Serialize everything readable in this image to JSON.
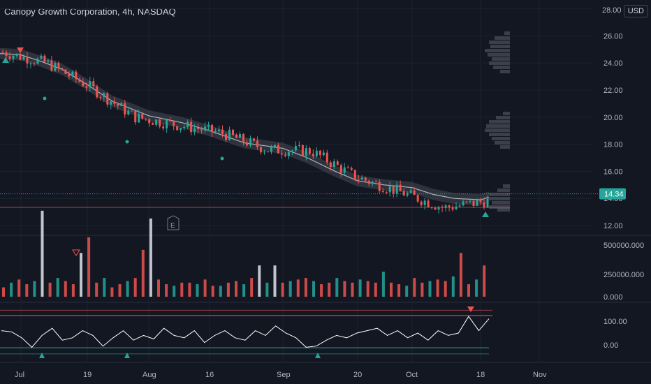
{
  "header": {
    "title": "Canopy Growth Corporation, 4h, NASDAQ",
    "currency": "USD"
  },
  "price_axis": [
    "28.00",
    "26.00",
    "24.00",
    "22.00",
    "20.00",
    "18.00",
    "16.00",
    "14.00",
    "12.00"
  ],
  "last_price": "14.34",
  "volume_axis": [
    "500000.000",
    "250000.000",
    "0.000"
  ],
  "osc_axis": [
    "100.00",
    "0.00"
  ],
  "time_axis": [
    "Jul",
    "19",
    "Aug",
    "16",
    "Sep",
    "20",
    "Oct",
    "18",
    "Nov"
  ],
  "earnings_marker": "E",
  "colors": {
    "up": "#26a69a",
    "down": "#ef5350",
    "bg": "#131722",
    "grid": "#1e222d",
    "ma": "#d1d4dc",
    "green_arrow": "#26a69a",
    "red_arrow": "#ef5350"
  },
  "chart_data": [
    {
      "type": "line",
      "title": "Canopy Growth Corporation, 4h, NASDAQ",
      "ylim": [
        12,
        28
      ],
      "x": [
        "Jul",
        "Jul",
        "19",
        "Aug",
        "Aug",
        "16",
        "Sep",
        "Sep",
        "20",
        "Oct",
        "Oct",
        "18"
      ],
      "series": [
        {
          "values": [
            24.8,
            24.0,
            22.2,
            20.0,
            19.4,
            18.8,
            17.6,
            17.5,
            15.6,
            14.5,
            13.3,
            13.8
          ]
        }
      ],
      "current_value": 14.34,
      "grid": true
    },
    {
      "type": "bar",
      "ylim": [
        0,
        600000
      ],
      "values": [
        60000,
        90000,
        110000,
        80000,
        100000,
        550000,
        90000,
        120000,
        100000,
        80000,
        280000,
        380000,
        90000,
        120000,
        60000,
        80000,
        100000,
        120000,
        300000,
        500000,
        110000,
        80000,
        70000,
        90000,
        90000,
        80000,
        110000,
        70000,
        70000,
        90000,
        100000,
        80000,
        120000,
        200000,
        90000,
        200000,
        90000,
        100000,
        110000,
        120000,
        100000,
        80000,
        90000,
        120000,
        100000,
        90000,
        110000,
        100000,
        90000,
        160000,
        90000,
        80000,
        70000,
        120000,
        90000,
        100000,
        110000,
        100000,
        130000,
        280000,
        80000,
        110000,
        200000
      ]
    },
    {
      "type": "line",
      "ylim": [
        -40,
        160
      ],
      "series": [
        {
          "values": [
            60,
            55,
            30,
            -10,
            40,
            70,
            20,
            30,
            60,
            40,
            -5,
            30,
            60,
            20,
            40,
            25,
            70,
            40,
            30,
            60,
            10,
            40,
            60,
            30,
            20,
            60,
            40,
            80,
            50,
            30,
            -10,
            -5,
            20,
            40,
            30,
            50,
            60,
            70,
            40,
            60,
            30,
            50,
            20,
            60,
            40,
            50,
            120,
            60,
            110
          ]
        }
      ]
    }
  ]
}
